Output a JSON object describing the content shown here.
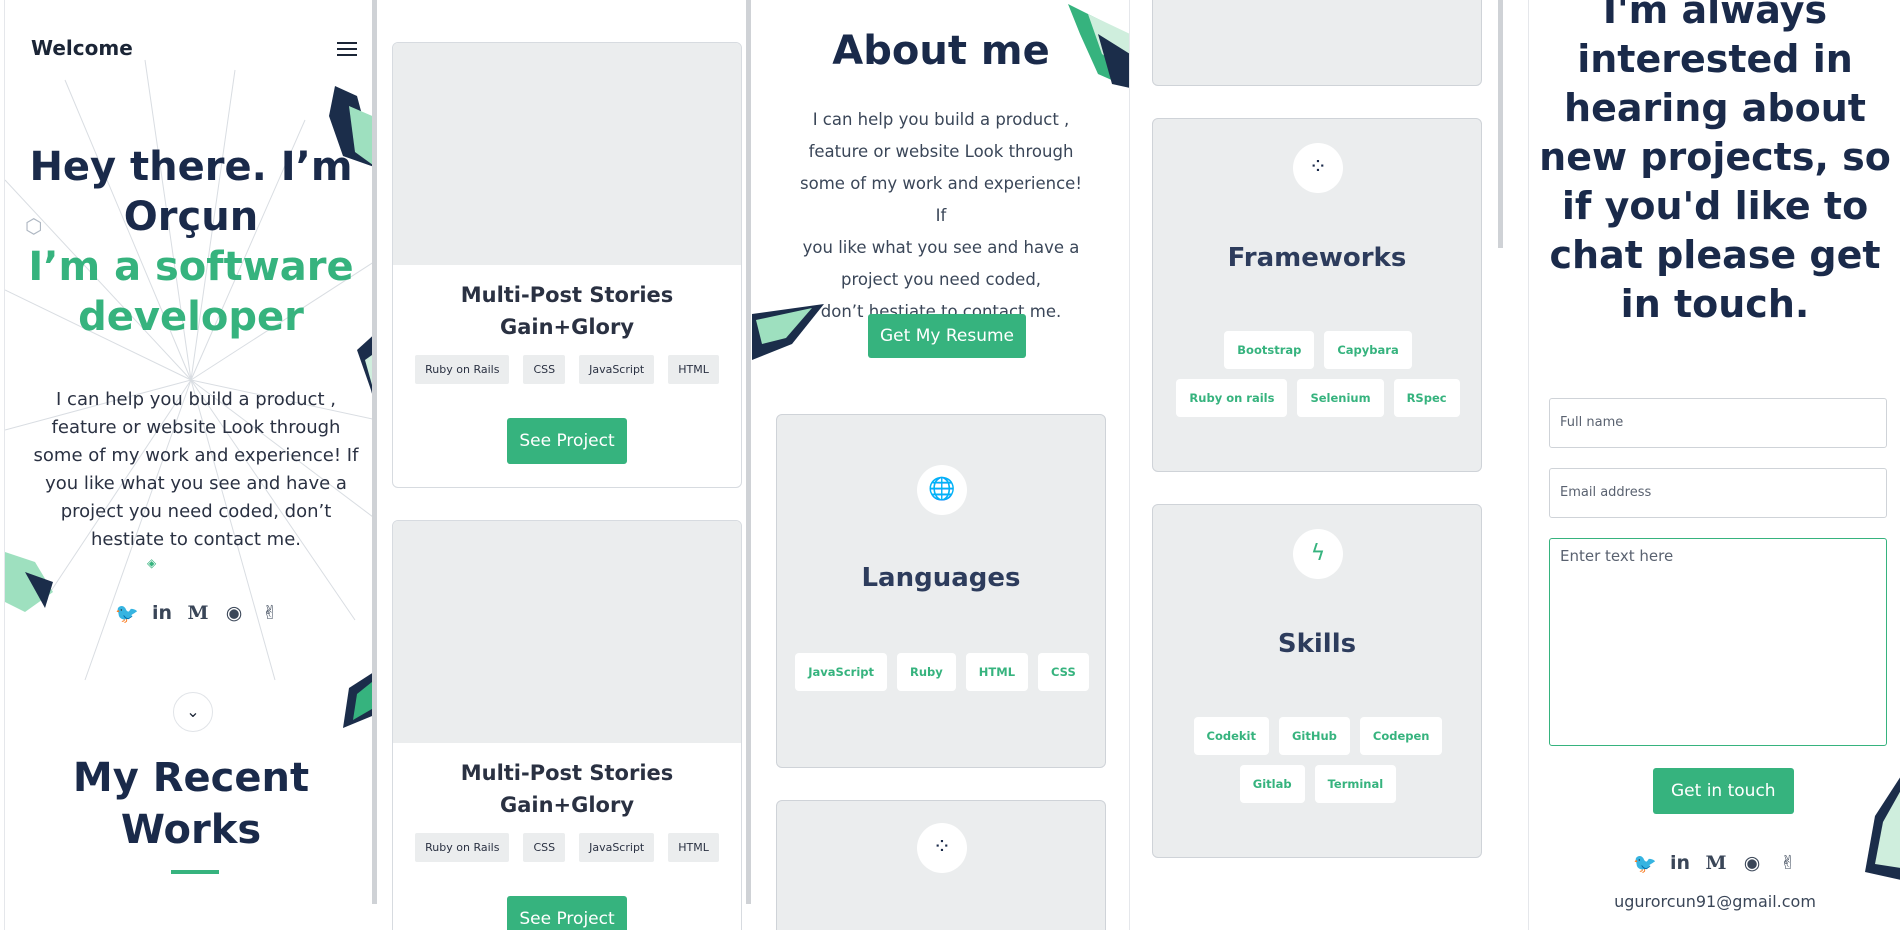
{
  "colors": {
    "accent": "#36b37e",
    "navy": "#1a2a4a",
    "card_bg": "#ebedee"
  },
  "panel1": {
    "brand": "Welcome",
    "menu_icon": "hamburger-icon",
    "hero_line1": "Hey there. I’m",
    "hero_line2": "Orçun",
    "hero_sub1": "I’m a software",
    "hero_sub2": "developer",
    "intro": "I can help you build a product , feature or website Look through some of my work and experience! If you like what you see and have a project you need coded, don’t hestiate to contact me.",
    "social_icons": [
      "twitter-icon",
      "linkedin-icon",
      "medium-icon",
      "github-icon",
      "angellist-icon"
    ],
    "scroll_icon": "chevron-down-icon",
    "section_title_1": "My Recent",
    "section_title_2": "Works"
  },
  "panel2": {
    "projects": [
      {
        "title": "Multi-Post Stories Gain+Glory",
        "tags": [
          "Ruby on Rails",
          "CSS",
          "JavaScript",
          "HTML"
        ],
        "button": "See Project"
      },
      {
        "title": "Multi-Post Stories Gain+Glory",
        "tags": [
          "Ruby on Rails",
          "CSS",
          "JavaScript",
          "HTML"
        ],
        "button": "See Project"
      }
    ]
  },
  "panel3": {
    "title": "About me",
    "text_lines": [
      "I can help you build a product ,",
      "feature or website Look through",
      "some of my work and experience! If",
      "you like what you see and have a",
      "project you need coded,",
      "don’t hestiate to contact me."
    ],
    "resume_button": "Get My Resume",
    "languages": {
      "icon": "globe-icon",
      "title": "Languages",
      "items": [
        "JavaScript",
        "Ruby",
        "HTML",
        "CSS"
      ]
    },
    "next_icon": "drone-icon"
  },
  "panel4": {
    "frameworks": {
      "icon": "drone-icon",
      "title": "Frameworks",
      "items": [
        "Bootstrap",
        "Capybara",
        "Ruby on rails",
        "Selenium",
        "RSpec"
      ]
    },
    "skills": {
      "icon": "lightning-icon",
      "title": "Skills",
      "items": [
        "Codekit",
        "GitHub",
        "Codepen",
        "Gitlab",
        "Terminal"
      ]
    }
  },
  "panel5": {
    "contact_lines": [
      "I'm always",
      "interested in",
      "hearing about",
      "new projects, so",
      "if you'd like to",
      "chat please get",
      "in touch."
    ],
    "full_name_placeholder": "Full name",
    "email_placeholder": "Email address",
    "message_placeholder": "Enter text here",
    "submit": "Get in touch",
    "social_icons": [
      "twitter-icon",
      "linkedin-icon",
      "medium-icon",
      "github-icon",
      "angellist-icon"
    ],
    "email": "ugurorcun91@gmail.com"
  }
}
